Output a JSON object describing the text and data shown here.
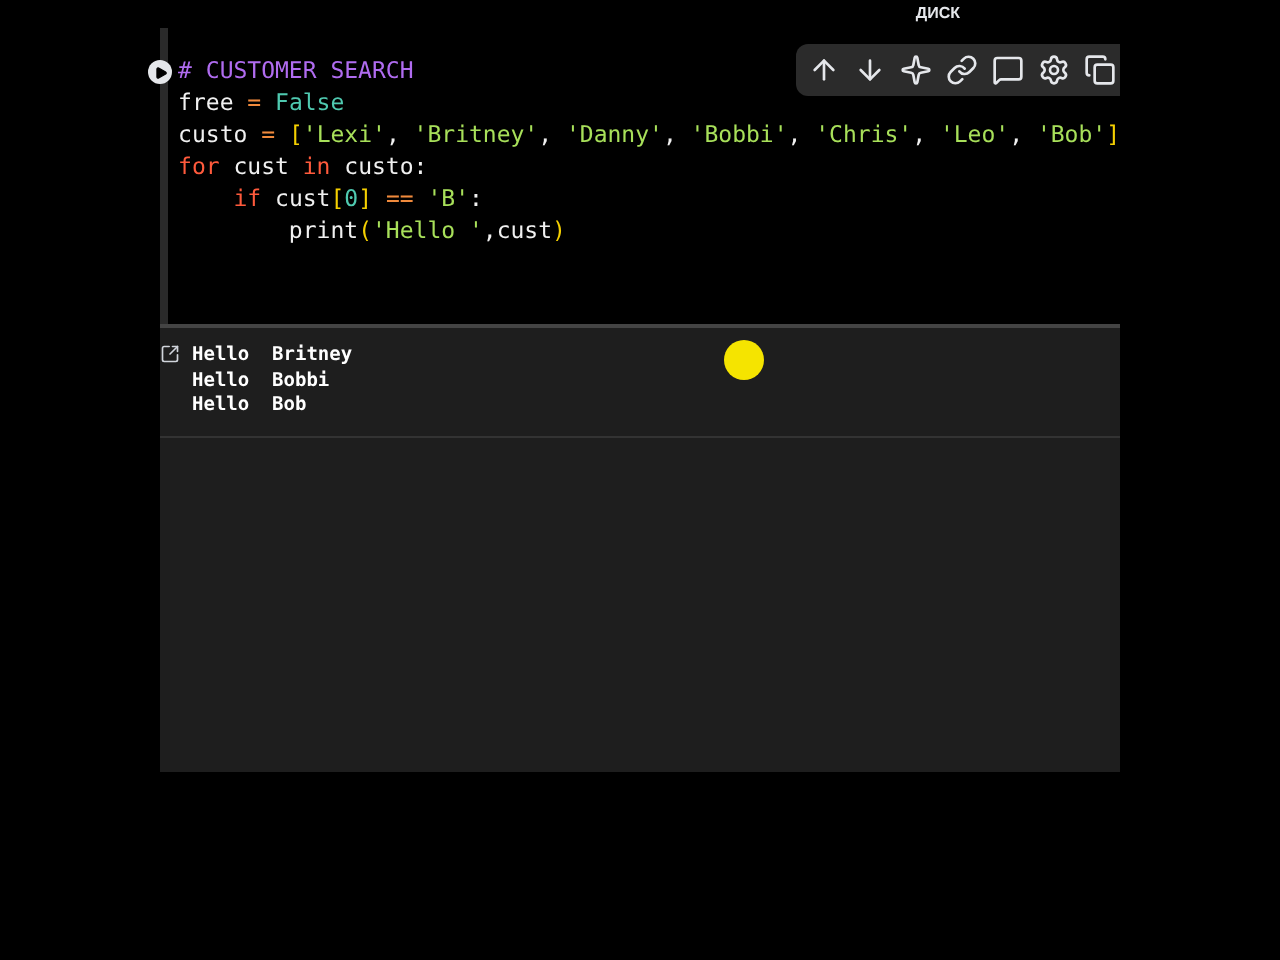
{
  "top_bar": {
    "label": "ДИСК"
  },
  "toolbar": {
    "buttons": [
      {
        "kind": "up"
      },
      {
        "kind": "down"
      },
      {
        "kind": "sparkle"
      },
      {
        "kind": "link"
      },
      {
        "kind": "comment"
      },
      {
        "kind": "settings"
      },
      {
        "kind": "copy"
      }
    ]
  },
  "code_lines": [
    [
      {
        "text": "# CUSTOMER SEARCH",
        "kind": "comment"
      }
    ],
    [
      {
        "text": "free ",
        "kind": "plain"
      },
      {
        "text": "= ",
        "kind": "operator"
      },
      {
        "text": "False",
        "kind": "literal"
      }
    ],
    [
      {
        "text": "custo ",
        "kind": "plain"
      },
      {
        "text": "= ",
        "kind": "operator"
      },
      {
        "text": "[",
        "kind": "bracket"
      },
      {
        "text": "'Lexi'",
        "kind": "string"
      },
      {
        "text": ", ",
        "kind": "plain"
      },
      {
        "text": "'Britney'",
        "kind": "string"
      },
      {
        "text": ", ",
        "kind": "plain"
      },
      {
        "text": "'Danny'",
        "kind": "string"
      },
      {
        "text": ", ",
        "kind": "plain"
      },
      {
        "text": "'Bobbi'",
        "kind": "string"
      },
      {
        "text": ", ",
        "kind": "plain"
      },
      {
        "text": "'Chris'",
        "kind": "string"
      },
      {
        "text": ", ",
        "kind": "plain"
      },
      {
        "text": "'Leo'",
        "kind": "string"
      },
      {
        "text": ", ",
        "kind": "plain"
      },
      {
        "text": "'Bob'",
        "kind": "string"
      },
      {
        "text": "]",
        "kind": "bracket"
      }
    ],
    [
      {
        "text": "for",
        "kind": "keyword"
      },
      {
        "text": " cust ",
        "kind": "plain"
      },
      {
        "text": "in",
        "kind": "keyword"
      },
      {
        "text": " custo:",
        "kind": "plain"
      }
    ],
    [
      {
        "text": "    if",
        "kind": "keyword"
      },
      {
        "text": " cust",
        "kind": "plain"
      },
      {
        "text": "[",
        "kind": "bracket"
      },
      {
        "text": "0",
        "kind": "literal"
      },
      {
        "text": "]",
        "kind": "bracket"
      },
      {
        "text": " == ",
        "kind": "operator"
      },
      {
        "text": "'B'",
        "kind": "string"
      },
      {
        "text": ":",
        "kind": "plain"
      }
    ],
    [
      {
        "text": "        print",
        "kind": "plain"
      },
      {
        "text": "(",
        "kind": "bracket"
      },
      {
        "text": "'Hello '",
        "kind": "string"
      },
      {
        "text": ",cust",
        "kind": "plain"
      },
      {
        "text": ")",
        "kind": "bracket"
      }
    ]
  ],
  "output_lines": [
    "Hello  Britney",
    "Hello  Bobbi",
    "Hello  Bob"
  ]
}
